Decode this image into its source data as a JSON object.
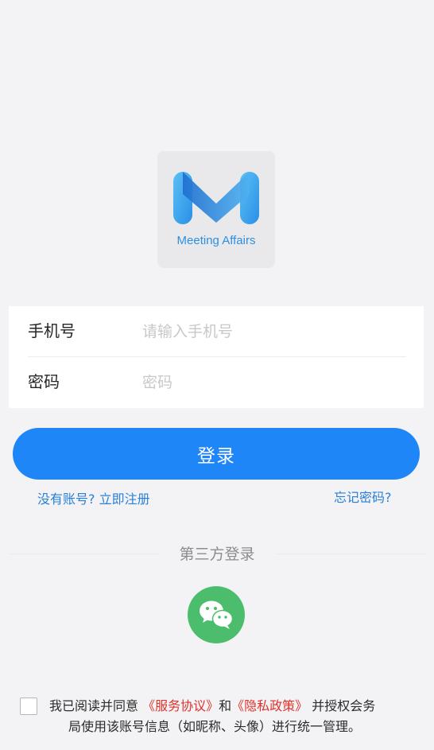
{
  "logo": {
    "text": "Meeting Affairs"
  },
  "form": {
    "phone_label": "手机号",
    "phone_placeholder": "请输入手机号",
    "phone_value": "",
    "password_label": "密码",
    "password_placeholder": "密码",
    "password_value": ""
  },
  "login_button": "登录",
  "links": {
    "register": "没有账号? 立即注册",
    "forgot": "忘记密码?"
  },
  "third_party": {
    "title": "第三方登录"
  },
  "agreement": {
    "checked": false,
    "prefix": "我已阅读并同意 ",
    "service": "《服务协议》",
    "and": "和",
    "privacy": "《隐私政策》",
    "suffix": " 并授权会务",
    "line2": "局使用该账号信息（如昵称、头像）进行统一管理。"
  },
  "colors": {
    "primary": "#1f86f8",
    "wechat": "#4bbd6c",
    "policy_link": "#e0322b",
    "link": "#2a7fd8"
  }
}
